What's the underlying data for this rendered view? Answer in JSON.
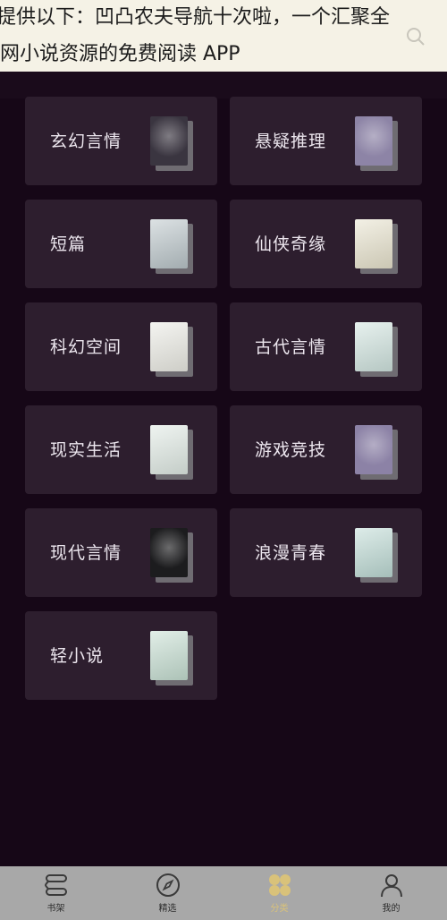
{
  "caption": {
    "line1": "提供以下：凹凸农夫导航十次啦，一个汇聚全",
    "line2": "网小说资源的免费阅读 APP"
  },
  "categories": [
    {
      "label": "玄幻言情",
      "cover_color": "#3a3540",
      "cover_icon": "fantasy-cover-icon"
    },
    {
      "label": "悬疑推理",
      "cover_color": "#8d84a6",
      "cover_icon": "mystery-cover-icon"
    },
    {
      "label": "短篇",
      "cover_color": "#b9c4c8",
      "cover_icon": "short-story-cover-icon"
    },
    {
      "label": "仙侠奇缘",
      "cover_color": "#e7e2cc",
      "cover_icon": "xianxia-cover-icon"
    },
    {
      "label": "科幻空间",
      "cover_color": "#eaeae3",
      "cover_icon": "scifi-cover-icon"
    },
    {
      "label": "古代言情",
      "cover_color": "#cfe3de",
      "cover_icon": "ancient-romance-cover-icon"
    },
    {
      "label": "现实生活",
      "cover_color": "#dfe9e3",
      "cover_icon": "real-life-cover-icon"
    },
    {
      "label": "游戏竞技",
      "cover_color": "#8c82a6",
      "cover_icon": "gaming-cover-icon"
    },
    {
      "label": "现代言情",
      "cover_color": "#1c1c1e",
      "cover_icon": "modern-romance-cover-icon"
    },
    {
      "label": "浪漫青春",
      "cover_color": "#bcd9d3",
      "cover_icon": "youth-cover-icon"
    },
    {
      "label": "轻小说",
      "cover_color": "#c4ddd0",
      "cover_icon": "light-novel-cover-icon"
    }
  ],
  "nav": [
    {
      "label": "书架",
      "icon": "bookshelf-icon",
      "active": false
    },
    {
      "label": "精选",
      "icon": "compass-icon",
      "active": false
    },
    {
      "label": "分类",
      "icon": "category-icon",
      "active": true
    },
    {
      "label": "我的",
      "icon": "profile-icon",
      "active": false
    }
  ],
  "colors": {
    "background": "#160717",
    "card": "#2d1e2e",
    "nav_background": "#a8a8a8",
    "nav_active": "#d9c27a"
  }
}
